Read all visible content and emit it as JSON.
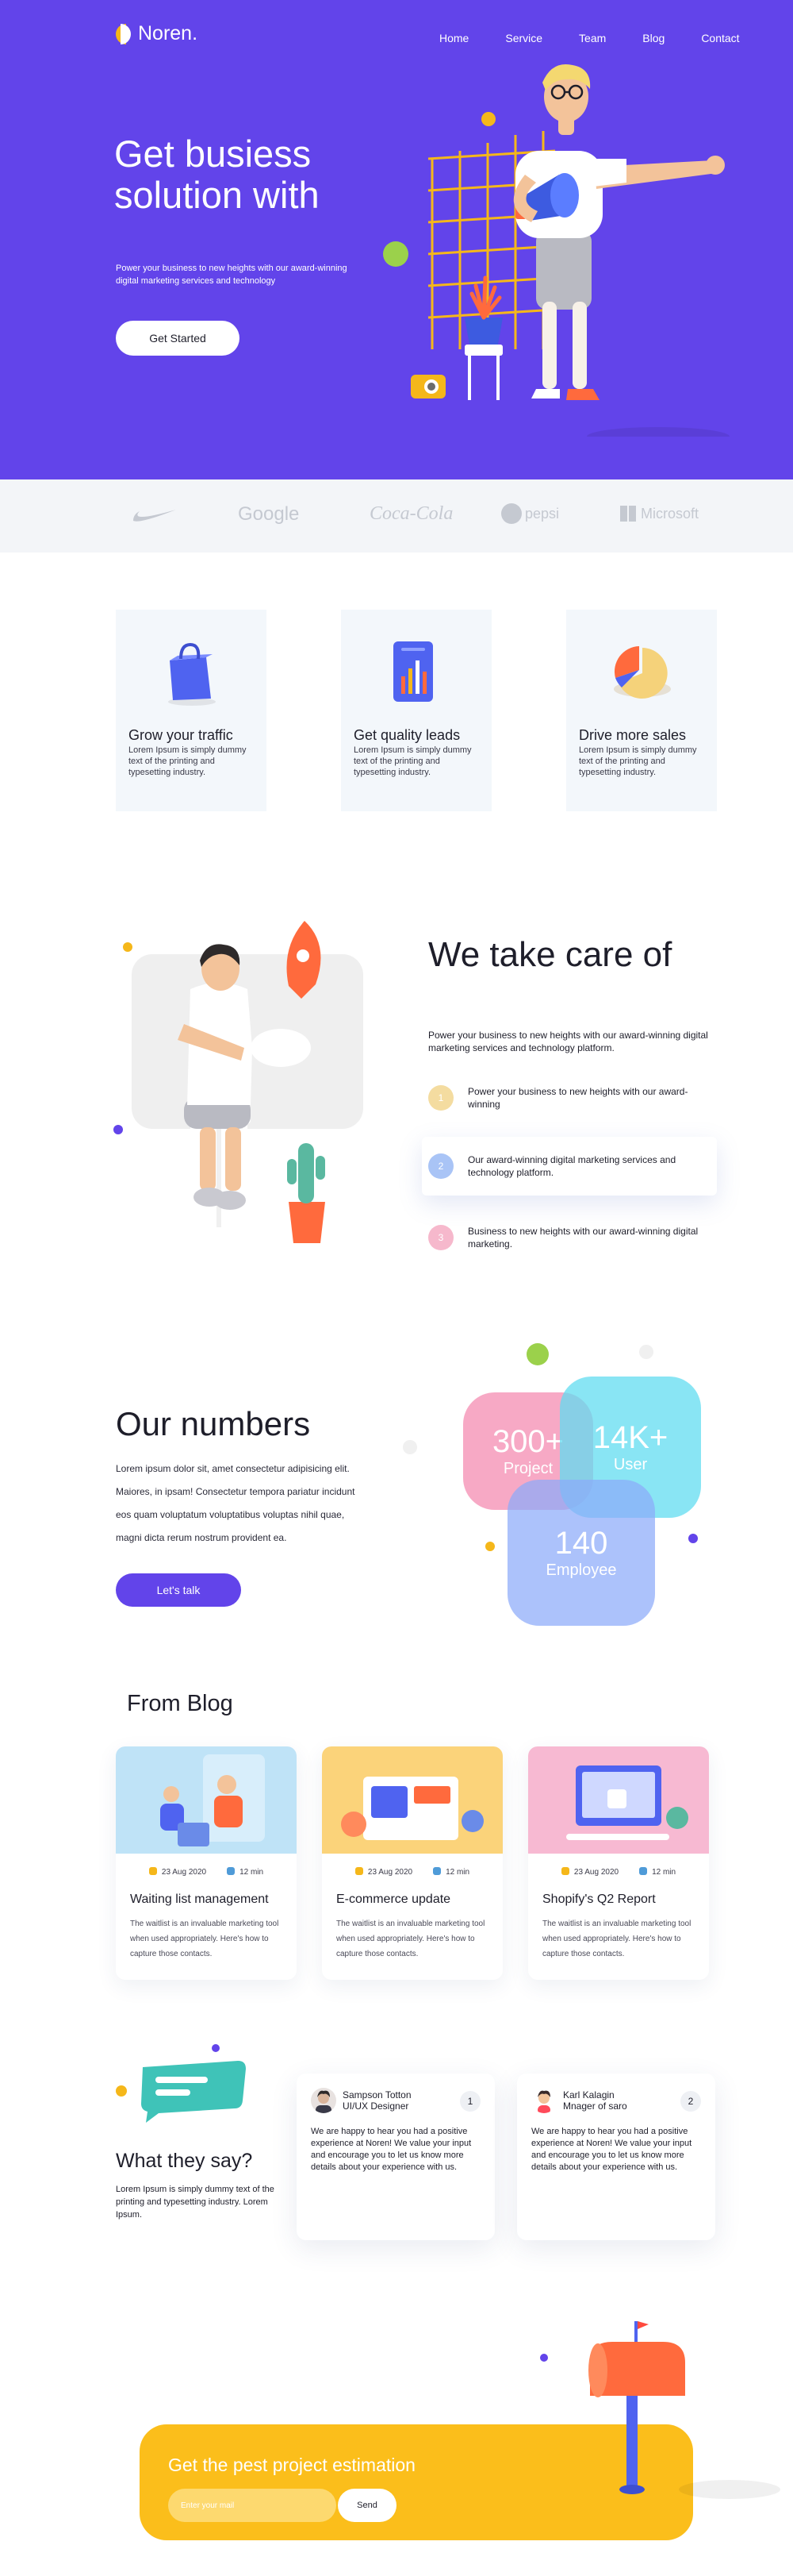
{
  "brand": {
    "name": "Noren."
  },
  "nav": {
    "items": [
      "Home",
      "Service",
      "Team",
      "Blog",
      "Contact"
    ]
  },
  "hero": {
    "title": "Get busiess solution with",
    "subtitle": "Power your business to new heights with our award-winning digital marketing services and technology",
    "cta": "Get Started"
  },
  "partners": [
    "Google",
    "Coca-Cola",
    "pepsi",
    "Microsoft"
  ],
  "features": [
    {
      "title": "Grow your traffic",
      "text": "Lorem Ipsum is simply dummy text of the printing and typesetting industry.",
      "icon": "shopping-bag-icon"
    },
    {
      "title": "Get quality leads",
      "text": "Lorem Ipsum is simply dummy text of the printing and typesetting industry.",
      "icon": "bar-chart-tablet-icon"
    },
    {
      "title": "Drive more sales",
      "text": "Lorem Ipsum is simply dummy text of the printing and typesetting industry.",
      "icon": "pie-chart-icon"
    }
  ],
  "care": {
    "title": "We take care of",
    "intro": "Power your business to new heights with our award-winning digital marketing services and technology platform.",
    "items": [
      {
        "num": "1",
        "text": "Power your business to new heights with our award-winning",
        "color": "#f4dca0"
      },
      {
        "num": "2",
        "text": "Our award-winning digital marketing services and technology platform.",
        "color": "#a9c4f6"
      },
      {
        "num": "3",
        "text": "Business to new heights with our award-winning digital marketing.",
        "color": "#f6b8cc"
      }
    ]
  },
  "numbers": {
    "title": "Our numbers",
    "text": "Lorem ipsum dolor sit, amet consectetur adipisicing elit. Maiores, in ipsam! Consectetur tempora pariatur incidunt eos quam voluptatum voluptatibus voluptas nihil quae, magni dicta rerum nostrum provident ea.",
    "cta": "Let's talk",
    "stats": [
      {
        "value": "300+",
        "label": "Project"
      },
      {
        "value": "14K+",
        "label": "User"
      },
      {
        "value": "140",
        "label": "Employee"
      }
    ]
  },
  "blog": {
    "title": "From Blog",
    "posts": [
      {
        "date": "23 Aug 2020",
        "read": "12 min",
        "title": "Waiting list management",
        "text": "The waitlist is an invaluable marketing tool when used appropriately. Here's how to capture those contacts."
      },
      {
        "date": "23 Aug 2020",
        "read": "12 min",
        "title": "E-commerce update",
        "text": "The waitlist is an invaluable marketing tool when used appropriately. Here's how to capture those contacts."
      },
      {
        "date": "23 Aug 2020",
        "read": "12 min",
        "title": "Shopify's Q2 Report",
        "text": "The waitlist is an invaluable marketing tool when used appropriately. Here's how to capture those contacts."
      }
    ]
  },
  "testimonials": {
    "title": "What they say?",
    "text": "Lorem Ipsum is simply dummy text of the printing and typesetting industry. Lorem Ipsum.",
    "items": [
      {
        "name": "Sampson Totton",
        "role": "UI/UX Designer",
        "index": "1",
        "text": "We are happy to hear you had a positive experience at Noren! We value your input and encourage you to let us know more details about your experience with us."
      },
      {
        "name": "Karl Kalagin",
        "role": "Mnager of saro",
        "index": "2",
        "text": "We are happy to hear you had a positive experience at Noren! We value your input and encourage you to let us know more details about your experience with us."
      }
    ]
  },
  "cta": {
    "title": "Get the pest project estimation",
    "placeholder": "Enter your mail",
    "button": "Send"
  },
  "colors": {
    "primary": "#6244ea",
    "accent_yellow": "#fbbe1b",
    "light_bg": "#f3f7fb"
  }
}
